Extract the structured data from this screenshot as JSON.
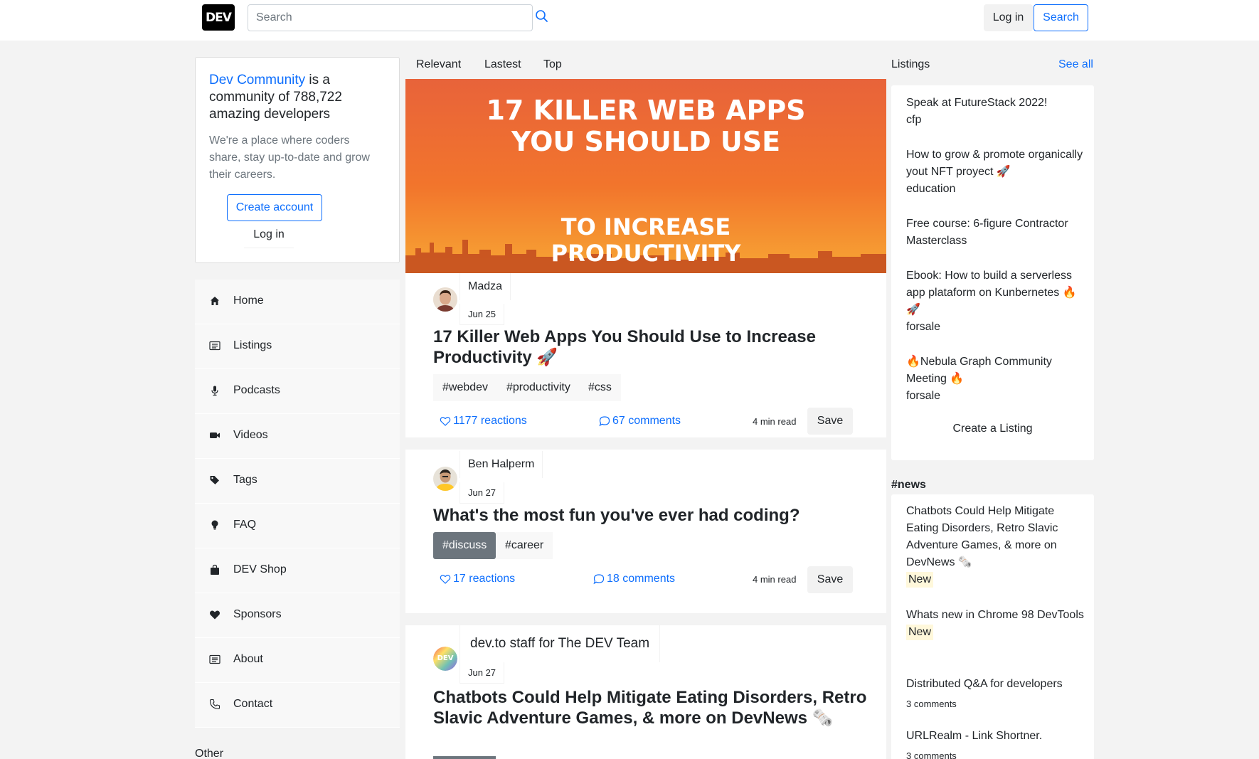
{
  "header": {
    "logo_text": "DEV",
    "search_placeholder": "Search",
    "login_label": "Log in",
    "search_button_label": "Search"
  },
  "intro": {
    "community_link": "Dev Community",
    "title_rest": " is a community of 788,722 amazing developers",
    "description": "We're a place where coders share, stay up-to-date and grow their careers.",
    "create_account_label": "Create account",
    "login_label": "Log in"
  },
  "nav": {
    "items": [
      {
        "label": "Home",
        "icon": "home-icon"
      },
      {
        "label": "Listings",
        "icon": "listings-icon"
      },
      {
        "label": "Podcasts",
        "icon": "microphone-icon"
      },
      {
        "label": "Videos",
        "icon": "video-camera-icon"
      },
      {
        "label": "Tags",
        "icon": "tags-icon"
      },
      {
        "label": "FAQ",
        "icon": "lightbulb-icon"
      },
      {
        "label": "DEV Shop",
        "icon": "shopping-bag-icon"
      },
      {
        "label": "Sponsors",
        "icon": "heart-icon"
      },
      {
        "label": "About",
        "icon": "about-icon"
      },
      {
        "label": "Contact",
        "icon": "phone-icon"
      }
    ],
    "other_label": "Other"
  },
  "feed": {
    "tabs": [
      "Relevant",
      "Lastest",
      "Top"
    ],
    "posts": [
      {
        "cover_line1": "17 KILLER WEB APPS",
        "cover_line2": "YOU SHOULD USE",
        "cover_line3": "TO INCREASE",
        "cover_line4": "PRODUCTIVITY",
        "author": "Madza",
        "date": "Jun 25",
        "title": "17 Killer Web Apps You Should Use to Increase Productivity 🚀",
        "tags": [
          "#webdev",
          "#productivity",
          "#css"
        ],
        "reactions": "1177 reactions",
        "comments": "67 comments",
        "read_time": "4 min read",
        "save_label": "Save"
      },
      {
        "author": "Ben Halperm",
        "date": "Jun 27",
        "title": "What's the most fun you've ever had coding?",
        "tags": [
          "#discuss",
          "#career"
        ],
        "reactions": "17 reactions",
        "comments": "18 comments",
        "read_time": "4 min read",
        "save_label": "Save"
      },
      {
        "author": "dev.to staff for The DEV Team",
        "avatar_text": "DEV",
        "date": "Jun 27",
        "title": "Chatbots Could Help Mitigate Eating Disorders, Retro Slavic Adventure Games, & more on DevNews 🗞️"
      }
    ]
  },
  "listings": {
    "heading": "Listings",
    "see_all": "See all",
    "items": [
      {
        "title": "Speak at FutureStack 2022!",
        "category": "cfp"
      },
      {
        "title": "How to grow & promote organically yout NFT proyect 🚀",
        "category": "education"
      },
      {
        "title": "Free course: 6-figure Contractor Masterclass",
        "category": ""
      },
      {
        "title": "Ebook: How to build a serverless app plataform on Kunbernetes 🔥 🚀",
        "category": "forsale"
      },
      {
        "title": "🔥Nebula Graph Community Meeting 🔥",
        "category": "forsale"
      }
    ],
    "create_label": "Create a Listing"
  },
  "news": {
    "heading": "#news",
    "items": [
      {
        "title": "Chatbots Could Help Mitigate Eating Disorders, Retro Slavic Adventure Games, & more on DevNews 🗞️",
        "badge": "New"
      },
      {
        "title": "Whats new in Chrome 98 DevTools",
        "badge": "New"
      },
      {
        "title": "Distributed Q&A for developers",
        "meta": "3 comments"
      },
      {
        "title": "URLRealm - Link Shortner.",
        "meta": "3 comments"
      }
    ]
  },
  "colors": {
    "accent": "#0d6efd",
    "page_bg": "#f3f3f3",
    "tag_active": "#6c757d",
    "badge_new": "#fff8db"
  }
}
